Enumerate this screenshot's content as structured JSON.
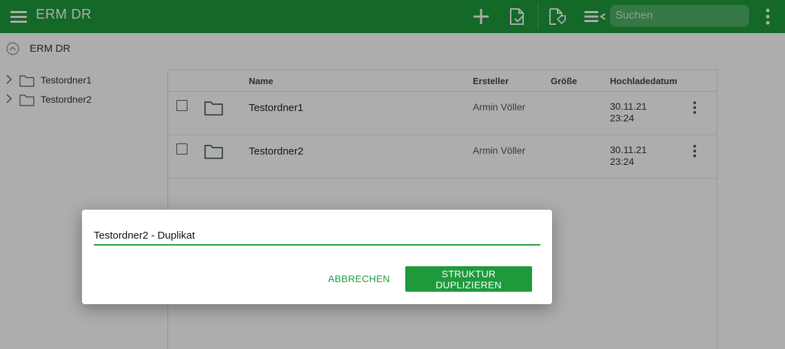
{
  "header": {
    "app_title": "ERM DR",
    "search_placeholder": "Suchen",
    "icons": [
      "menu-icon",
      "add-icon",
      "document-check-icon",
      "document-tag-icon",
      "list-sort-icon",
      "more-vert-icon"
    ],
    "color": "#1e9a3c"
  },
  "breadcrumb": {
    "label": "ERM DR",
    "icon": "collapse-up-icon"
  },
  "tree": {
    "items": [
      {
        "label": "Testordner1"
      },
      {
        "label": "Testordner2"
      }
    ]
  },
  "table": {
    "columns": {
      "name": "Name",
      "creator": "Ersteller",
      "size": "Größe",
      "uploaded": "Hochladedatum"
    },
    "rows": [
      {
        "name": "Testordner1",
        "creator": "Armin Völler",
        "size": "",
        "date": "30.11.21",
        "time": "23:24"
      },
      {
        "name": "Testordner2",
        "creator": "Armin Völler",
        "size": "",
        "date": "30.11.21",
        "time": "23:24"
      }
    ]
  },
  "dialog": {
    "input_value": "Testordner2 - Duplikat",
    "cancel_label": "ABBRECHEN",
    "confirm_label": "STRUKTUR DUPLIZIEREN"
  }
}
